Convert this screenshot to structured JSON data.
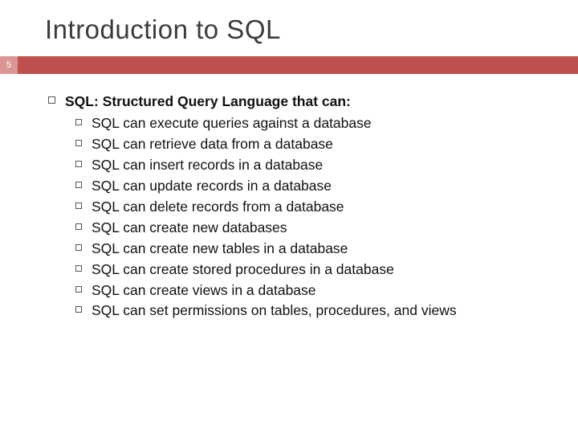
{
  "slide": {
    "title": "Introduction to SQL",
    "page": "5",
    "lead": "SQL: Structured Query Language that can:",
    "items": [
      "SQL can execute queries against a database",
      "SQL can retrieve data from a database",
      "SQL can insert records in a database",
      "SQL can update records in a database",
      "SQL can delete records from a database",
      "SQL can create new databases",
      "SQL can create new tables in a database",
      "SQL can create stored procedures in a database",
      "SQL can create views in a database",
      "SQL can set permissions on tables, procedures, and views"
    ]
  }
}
